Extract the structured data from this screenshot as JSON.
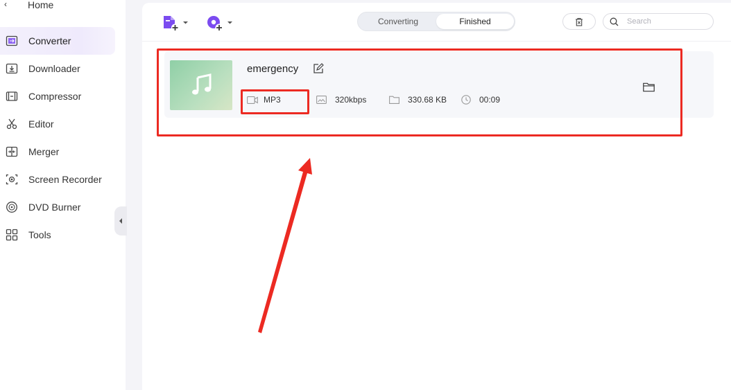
{
  "sidebar": {
    "home_label": "Home",
    "items": [
      {
        "label": "Converter",
        "icon": "converter-icon",
        "active": true
      },
      {
        "label": "Downloader",
        "icon": "download-icon",
        "active": false
      },
      {
        "label": "Compressor",
        "icon": "compress-icon",
        "active": false
      },
      {
        "label": "Editor",
        "icon": "scissors-icon",
        "active": false
      },
      {
        "label": "Merger",
        "icon": "merge-icon",
        "active": false
      },
      {
        "label": "Screen Recorder",
        "icon": "screen-record-icon",
        "active": false
      },
      {
        "label": "DVD Burner",
        "icon": "disc-icon",
        "active": false
      },
      {
        "label": "Tools",
        "icon": "tools-grid-icon",
        "active": false
      }
    ]
  },
  "toolbar": {
    "tabs": [
      {
        "label": "Converting",
        "selected": false
      },
      {
        "label": "Finished",
        "selected": true
      }
    ],
    "search_placeholder": "Search",
    "accent_color": "#7b4bf0"
  },
  "file": {
    "name": "emergency",
    "format": "MP3",
    "bitrate": "320kbps",
    "size": "330.68 KB",
    "duration": "00:09"
  },
  "annotation_color": "#ec2a22"
}
